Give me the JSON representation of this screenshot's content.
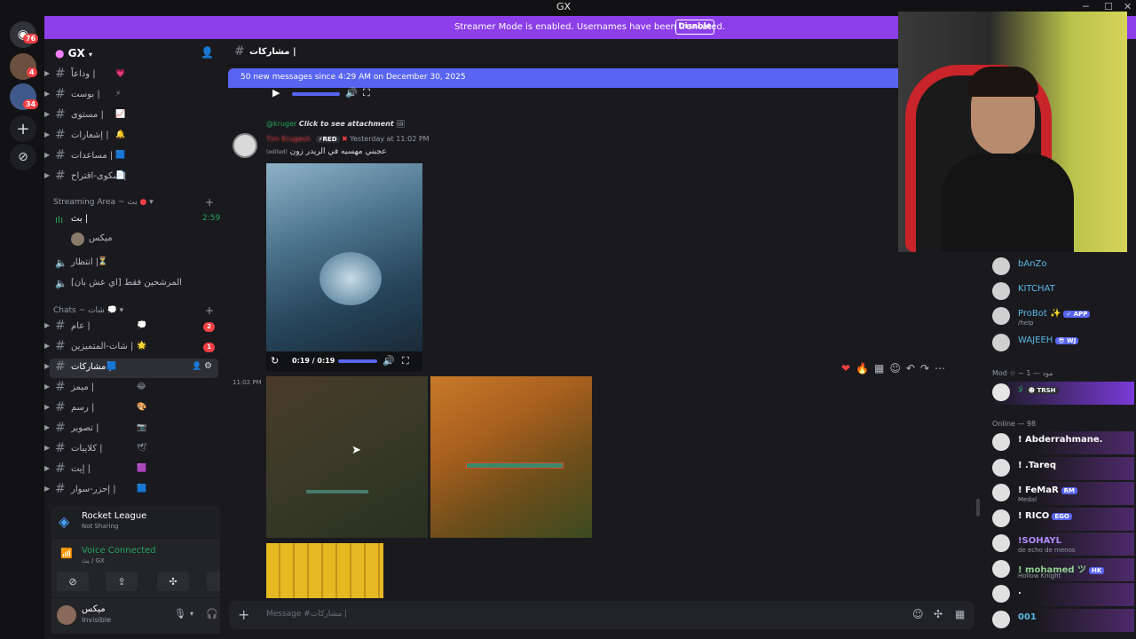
{
  "window": {
    "title": "GX"
  },
  "banner": {
    "text": "Streamer Mode is enabled. Usernames have been truncated.",
    "button": "Disable"
  },
  "rail": {
    "home_badge": "76",
    "srv1_badge": "4",
    "srv2_badge": "34"
  },
  "server": {
    "name": "GX"
  },
  "channels_top": [
    {
      "name": "وداعاً |",
      "emoji": "💗"
    },
    {
      "name": "بوست |",
      "emoji": "⚡"
    },
    {
      "name": "مستوى |",
      "emoji": "📈"
    },
    {
      "name": "إشعارات |",
      "emoji": "🔔"
    },
    {
      "name": "مساعدات |",
      "emoji": "🟦"
    },
    {
      "name": "شكوى-اقتراح |",
      "emoji": "📄"
    }
  ],
  "streaming": {
    "category": "Streaming Area ~ بث",
    "live_channel": "بث |",
    "live_time": "2:59:24",
    "live_user": "ميكس",
    "wait_channel": "انتظار |",
    "wait_emoji": "⏳",
    "candidates_channel": "المرشحين فقط [اي عش بان]"
  },
  "chats": {
    "category": "Chats ~ شات",
    "items": [
      {
        "name": "عام |",
        "emoji": "💭",
        "badge": "2"
      },
      {
        "name": "شات-المتميزين |",
        "emoji": "🌟",
        "badge": "1"
      },
      {
        "name": "مشاركات |",
        "emoji": "🟦",
        "badge": ""
      },
      {
        "name": "ميمز |",
        "emoji": "😂",
        "badge": ""
      },
      {
        "name": "رسم |",
        "emoji": "🎨",
        "badge": ""
      },
      {
        "name": "تصوير |",
        "emoji": "📷",
        "badge": ""
      },
      {
        "name": "كلايبات |",
        "emoji": "🕊",
        "badge": ""
      },
      {
        "name": "إيت |",
        "emoji": "🟪",
        "badge": ""
      },
      {
        "name": "إحزر-سوار |",
        "emoji": "🟦",
        "badge": ""
      }
    ]
  },
  "activity": {
    "title": "Rocket League",
    "sub": "Not Sharing"
  },
  "voice": {
    "status": "Voice Connected",
    "location": "بث / GX"
  },
  "user": {
    "name": "ميكس",
    "status": "Invisible"
  },
  "chat": {
    "channel": "مشاركات |",
    "new_messages": "50 new messages since 4:29 AM on December 30, 2025",
    "reply_user": "@kruger",
    "reply_text": "Click to see attachment",
    "author": "Tim Krugesh",
    "author_tag": "RED",
    "timestamp": "Yesterday at 11:02 PM",
    "edited": "(edited)",
    "message": "عجبني مهسيه في الريدر زون",
    "video_time": "0:19 / 0:19",
    "side_time": "11:02 PM",
    "composer_placeholder": "Message #مشاركات |"
  },
  "members": {
    "top": [
      {
        "name": "bAnZo",
        "color": "#5ab9e6",
        "tag": "",
        "sub": ""
      },
      {
        "name": "KITCHAT",
        "color": "#5ab9e6",
        "tag": "",
        "sub": ""
      },
      {
        "name": "ProBot ✨",
        "color": "#5ab9e6",
        "tag": "✓ APP",
        "sub": "/help"
      },
      {
        "name": "WAJEEH",
        "color": "#5ab9e6",
        "tag": "😎 WJ",
        "sub": ""
      }
    ],
    "mod_header": "Mod ☆ ~ مود — 1",
    "mod": {
      "name": "لا",
      "tag": "TRSH"
    },
    "online_header": "Online — 98",
    "online": [
      {
        "name": "! Abderrahmane.",
        "color": "#ffffff",
        "tag": "",
        "sub": ""
      },
      {
        "name": "! .Tareq",
        "color": "#ffffff",
        "tag": "",
        "sub": ""
      },
      {
        "name": "! FeMaR",
        "color": "#ffffff",
        "tag": "RM",
        "sub": "Medal"
      },
      {
        "name": "! RICO",
        "color": "#ffffff",
        "tag": "EGO",
        "sub": ""
      },
      {
        "name": "!SOHAYL",
        "color": "#b08cff",
        "tag": "",
        "sub": "de echo de menos"
      },
      {
        "name": "! mohamed ツ",
        "color": "#8fd18f",
        "tag": "HK",
        "sub": "Hollow Knight"
      },
      {
        "name": ".",
        "color": "#ffffff",
        "tag": "",
        "sub": ""
      },
      {
        "name": "001",
        "color": "#5ab9e6",
        "tag": "",
        "sub": ""
      }
    ]
  },
  "colors": {
    "accent": "#5865f2",
    "banner": "#8c3ee8",
    "danger": "#f23f43",
    "online": "#23a55a"
  }
}
